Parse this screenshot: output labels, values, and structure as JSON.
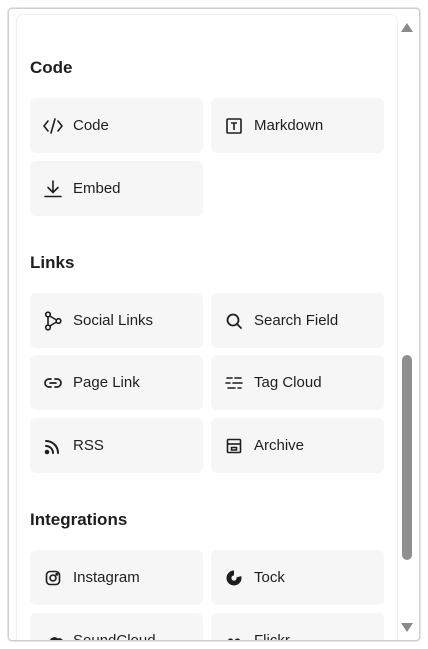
{
  "sections": [
    {
      "title": "Code",
      "items": [
        {
          "label": "Code",
          "icon": "code-icon"
        },
        {
          "label": "Markdown",
          "icon": "markdown-icon"
        },
        {
          "label": "Embed",
          "icon": "embed-icon"
        }
      ]
    },
    {
      "title": "Links",
      "items": [
        {
          "label": "Social Links",
          "icon": "share-icon"
        },
        {
          "label": "Search Field",
          "icon": "search-icon"
        },
        {
          "label": "Page Link",
          "icon": "link-icon"
        },
        {
          "label": "Tag Cloud",
          "icon": "tag-cloud-icon"
        },
        {
          "label": "RSS",
          "icon": "rss-icon"
        },
        {
          "label": "Archive",
          "icon": "archive-icon"
        }
      ]
    },
    {
      "title": "Integrations",
      "items": [
        {
          "label": "Instagram",
          "icon": "instagram-icon"
        },
        {
          "label": "Tock",
          "icon": "tock-icon"
        },
        {
          "label": "SoundCloud",
          "icon": "soundcloud-icon"
        },
        {
          "label": "Flickr",
          "icon": "flickr-icon"
        }
      ]
    }
  ],
  "colors": {
    "tile_bg": "#f6f6f6",
    "text": "#1e1e1e",
    "scroll_thumb": "#8f8f8f"
  }
}
